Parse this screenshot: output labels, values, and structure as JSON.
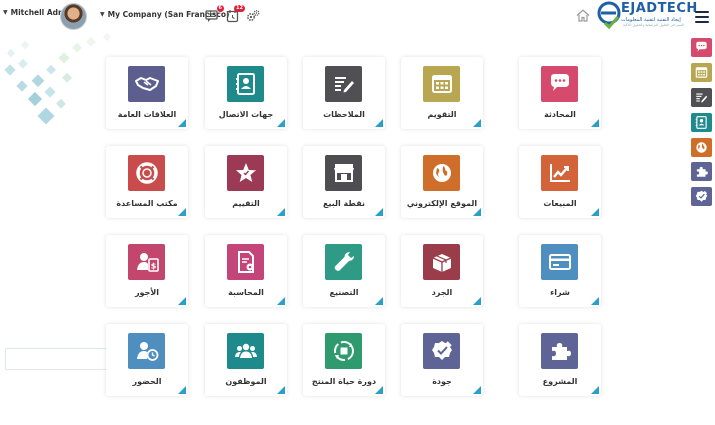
{
  "header": {
    "user_name": "Mitchell Admin",
    "company": "My Company (San Francisco)",
    "messages_badge": "6",
    "activities_badge": "12",
    "logo_title": "EJADTECH",
    "logo_sub1": "إيجاد التقنية لتقنية المعلومات",
    "logo_sub2": "التميز في الحلول البرامجية والحلول الذكية"
  },
  "apps": [
    {
      "label": "المحادثة",
      "icon": "chat-icon",
      "color": "#d64a6e"
    },
    {
      "label": "التقويم",
      "icon": "calendar-icon",
      "color": "#b8a651"
    },
    {
      "label": "الملاحظات",
      "icon": "notes-icon",
      "color": "#4f4f54"
    },
    {
      "label": "جهات الاتصال",
      "icon": "contacts-icon",
      "color": "#1f8a8c"
    },
    {
      "label": "العلاقات العامة",
      "icon": "handshake-icon",
      "color": "#5c5f8e"
    },
    {
      "label": "المبيعات",
      "icon": "sales-chart-icon",
      "color": "#d3643a"
    },
    {
      "label": "الموقع الإلكتروني",
      "icon": "globe-icon",
      "color": "#cf6e2b"
    },
    {
      "label": "نقطة البيع",
      "icon": "store-icon",
      "color": "#4d4d52"
    },
    {
      "label": "التقييم",
      "icon": "star-icon",
      "color": "#9c3a55"
    },
    {
      "label": "مكتب المساعدة",
      "icon": "lifebuoy-icon",
      "color": "#c94b4b"
    },
    {
      "label": "شراء",
      "icon": "credit-card-icon",
      "color": "#4f8fbf"
    },
    {
      "label": "الجرد",
      "icon": "box-icon",
      "color": "#9a3c4a"
    },
    {
      "label": "التصنيع",
      "icon": "wrench-icon",
      "color": "#2f9a86"
    },
    {
      "label": "المحاسبة",
      "icon": "invoice-icon",
      "color": "#c4457a"
    },
    {
      "label": "الأجور",
      "icon": "payroll-icon",
      "color": "#c2466e"
    },
    {
      "label": "المشروع",
      "icon": "puzzle-icon",
      "color": "#5e6596"
    },
    {
      "label": "جودة",
      "icon": "quality-icon",
      "color": "#5e6596"
    },
    {
      "label": "دورة حياة المنتج",
      "icon": "lifecycle-icon",
      "color": "#2f9a6e"
    },
    {
      "label": "الموظفون",
      "icon": "employees-icon",
      "color": "#1f8a8c"
    },
    {
      "label": "الحضور",
      "icon": "attendance-icon",
      "color": "#4f8fbf"
    }
  ],
  "sidebar": [
    {
      "icon": "chat-icon",
      "color": "#d64a6e"
    },
    {
      "icon": "calendar-icon",
      "color": "#b8a651"
    },
    {
      "icon": "notes-icon",
      "color": "#4f4f54"
    },
    {
      "icon": "contacts-icon",
      "color": "#1f8a8c"
    },
    {
      "icon": "globe-icon",
      "color": "#cf6e2b"
    },
    {
      "icon": "puzzle-icon",
      "color": "#5e6596"
    },
    {
      "icon": "quality-icon",
      "color": "#5e6596"
    }
  ]
}
